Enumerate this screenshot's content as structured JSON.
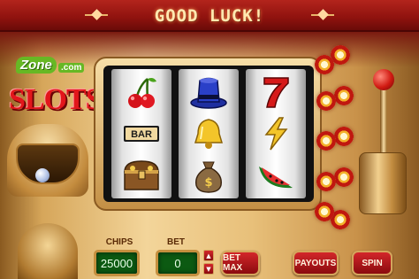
{
  "banner": {
    "title": "GOOD LUCK!"
  },
  "branding": {
    "zone_logo": "Zone",
    "zone_suffix": ".com",
    "game_logo": "SLOTS"
  },
  "reels": [
    {
      "symbols": [
        "cherries-icon",
        "bar-icon",
        "treasure-chest-icon"
      ]
    },
    {
      "symbols": [
        "top-hat-icon",
        "bell-icon",
        "money-bag-icon"
      ]
    },
    {
      "symbols": [
        "seven-icon",
        "lightning-icon",
        "watermelon-icon"
      ]
    }
  ],
  "controls": {
    "chips_label": "CHIPS",
    "chips_value": "25000",
    "bet_label": "BET",
    "bet_value": "0",
    "bet_up": "▲",
    "bet_down": "▼",
    "bet_max_label": "BET MAX",
    "payouts_label": "PAYOUTS",
    "spin_label": "SPIN"
  },
  "colors": {
    "banner_red": "#9e1812",
    "cabinet_gold": "#e8c07a",
    "led_green": "#0c5a12",
    "button_red": "#c41c20",
    "title_glow": "#ffe9b0"
  }
}
